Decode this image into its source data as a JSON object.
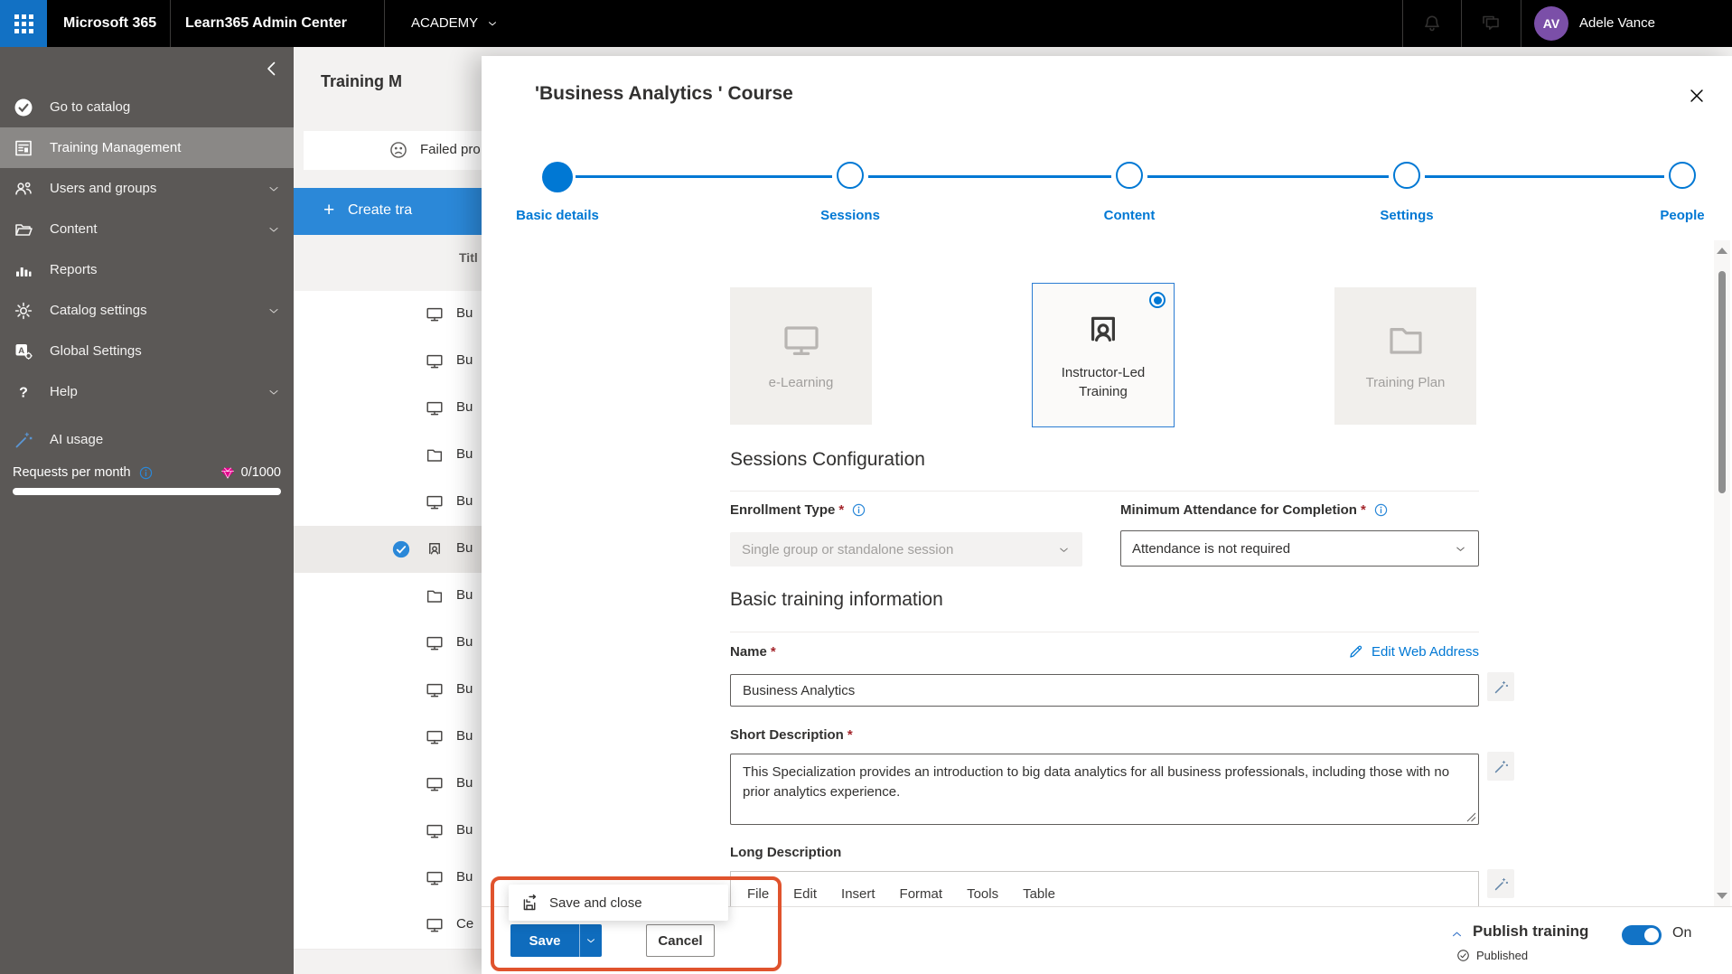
{
  "topbar": {
    "brand": "Microsoft 365",
    "app_title": "Learn365 Admin Center",
    "tenant": "ACADEMY",
    "user_name": "Adele Vance",
    "user_initials": "AV"
  },
  "sidebar": {
    "items": [
      {
        "icon": "catalog-check-icon",
        "label": "Go to catalog"
      },
      {
        "icon": "training-management-icon",
        "label": "Training Management",
        "selected": true
      },
      {
        "icon": "users-groups-icon",
        "label": "Users and groups",
        "chevron": true
      },
      {
        "icon": "content-folder-icon",
        "label": "Content",
        "chevron": true
      },
      {
        "icon": "reports-icon",
        "label": "Reports"
      },
      {
        "icon": "gear-icon",
        "label": "Catalog settings",
        "chevron": true
      },
      {
        "icon": "global-settings-icon",
        "label": "Global Settings"
      },
      {
        "icon": "help-icon",
        "label": "Help",
        "chevron": true
      },
      {
        "icon": "ai-wand-icon",
        "label": "AI usage",
        "accent": true
      }
    ],
    "requests_label": "Requests per month",
    "requests_value": "0/1000"
  },
  "list_panel": {
    "page_title": "Training M",
    "banner_text": "Failed pro",
    "create_button": "Create tra",
    "column_header": "Titl",
    "rows": [
      {
        "icon": "monitor-icon",
        "title": "Bu"
      },
      {
        "icon": "monitor-icon",
        "title": "Bu"
      },
      {
        "icon": "monitor-icon",
        "title": "Bu"
      },
      {
        "icon": "folder-icon",
        "title": "Bu"
      },
      {
        "icon": "monitor-icon",
        "title": "Bu"
      },
      {
        "icon": "instructor-icon",
        "title": "Bu",
        "selected": true
      },
      {
        "icon": "folder-icon",
        "title": "Bu"
      },
      {
        "icon": "monitor-icon",
        "title": "Bu"
      },
      {
        "icon": "monitor-icon",
        "title": "Bu"
      },
      {
        "icon": "monitor-icon",
        "title": "Bu"
      },
      {
        "icon": "monitor-icon",
        "title": "Bu"
      },
      {
        "icon": "monitor-icon",
        "title": "Bu"
      },
      {
        "icon": "monitor-icon",
        "title": "Bu"
      },
      {
        "icon": "monitor-icon",
        "title": "Ce"
      }
    ]
  },
  "dialog": {
    "title": "'Business Analytics ' Course",
    "steps": [
      {
        "label": "Basic details",
        "state": "active"
      },
      {
        "label": "Sessions",
        "state": "upcoming"
      },
      {
        "label": "Content",
        "state": "upcoming"
      },
      {
        "label": "Settings",
        "state": "upcoming"
      },
      {
        "label": "People",
        "state": "upcoming"
      }
    ],
    "training_types": [
      {
        "icon": "monitor-icon",
        "label": "e-Learning",
        "selected": false
      },
      {
        "icon": "instructor-icon",
        "label": "Instructor-Led Training",
        "selected": true
      },
      {
        "icon": "folder-icon",
        "label": "Training Plan",
        "selected": false
      }
    ],
    "sessions_config": {
      "heading": "Sessions Configuration",
      "enrollment_label": "Enrollment Type",
      "enrollment_value": "Single group or standalone session",
      "attendance_label": "Minimum Attendance for Completion",
      "attendance_value": "Attendance is not required"
    },
    "basic_info": {
      "heading": "Basic training information",
      "name_label": "Name",
      "name_value": "Business Analytics",
      "edit_web_address_label": "Edit Web Address",
      "short_description_label": "Short Description",
      "short_description_value": "This Specialization provides an introduction to big data analytics for all business professionals, including those with no prior analytics experience.",
      "long_description_label": "Long Description",
      "editor_menu": [
        "File",
        "Edit",
        "Insert",
        "Format",
        "Tools",
        "Table"
      ]
    },
    "footer": {
      "save_and_close_label": "Save and close",
      "save_label": "Save",
      "cancel_label": "Cancel",
      "publish_label": "Publish training",
      "toggle_state": "On",
      "status_label": "Published"
    }
  },
  "colors": {
    "accent": "#0078d4",
    "save_button": "#0f6cbd",
    "create_button": "#2b88d8",
    "highlight_box": "#e0532d",
    "success": "#107c10",
    "gem": "#e3008c",
    "avatar": "#7b4fa8",
    "waffle_button": "#1271c4",
    "sidebar_bg": "#5b5856",
    "sidebar_selected": "#8a8886"
  }
}
